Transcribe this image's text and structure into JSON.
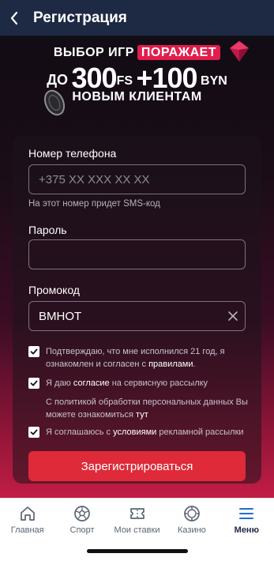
{
  "header": {
    "back_icon": "chevron-left-icon",
    "title": "Регистрация"
  },
  "banner": {
    "line1_text": "ВЫБОР ИГР",
    "line1_highlight": "ПОРАЖАЕТ",
    "line2_prefix": "ДО",
    "line2_fs_value": "300",
    "line2_fs_unit": "FS",
    "line2_bonus": "+100",
    "line2_currency": "BYN",
    "line3_text": "НОВЫМ КЛИЕНТАМ"
  },
  "form": {
    "phone_label": "Номер телефона",
    "phone_placeholder": "+375 XX XXX XX XX",
    "phone_value": "",
    "phone_hint": "На этот номер придет SMS-код",
    "password_label": "Пароль",
    "password_value": "",
    "promo_label": "Промокод",
    "promo_value": "BMHOT",
    "consents": [
      {
        "checked": true,
        "text_before": "Подтверждаю, что мне исполнился 21 год, я ознакомлен и согласен с ",
        "link": "правилами",
        "text_after": "."
      },
      {
        "checked": true,
        "text_before": "Я даю ",
        "link": "согласие",
        "text_after": " на сервисную рассылку"
      },
      {
        "checked": true,
        "text_before": "Я соглашаюсь с ",
        "link": "условиями",
        "text_after": " рекламной рассылки"
      }
    ],
    "privacy_note_before": "С политикой обработки персональных данных Вы можете ознакомиться ",
    "privacy_note_link": "тут",
    "submit_label": "Зарегистрироваться"
  },
  "bottom_nav": {
    "items": [
      {
        "label": "Главная",
        "icon": "home-icon",
        "active": false
      },
      {
        "label": "Спорт",
        "icon": "soccer-ball-icon",
        "active": false
      },
      {
        "label": "Мои ставки",
        "icon": "ticket-icon",
        "active": false
      },
      {
        "label": "Казино",
        "icon": "casino-chip-icon",
        "active": false
      },
      {
        "label": "Меню",
        "icon": "menu-icon",
        "active": true
      }
    ]
  },
  "colors": {
    "header_bg": "#1e2a44",
    "accent_red": "#df2a39",
    "highlight_pink": "#e11d4d"
  }
}
